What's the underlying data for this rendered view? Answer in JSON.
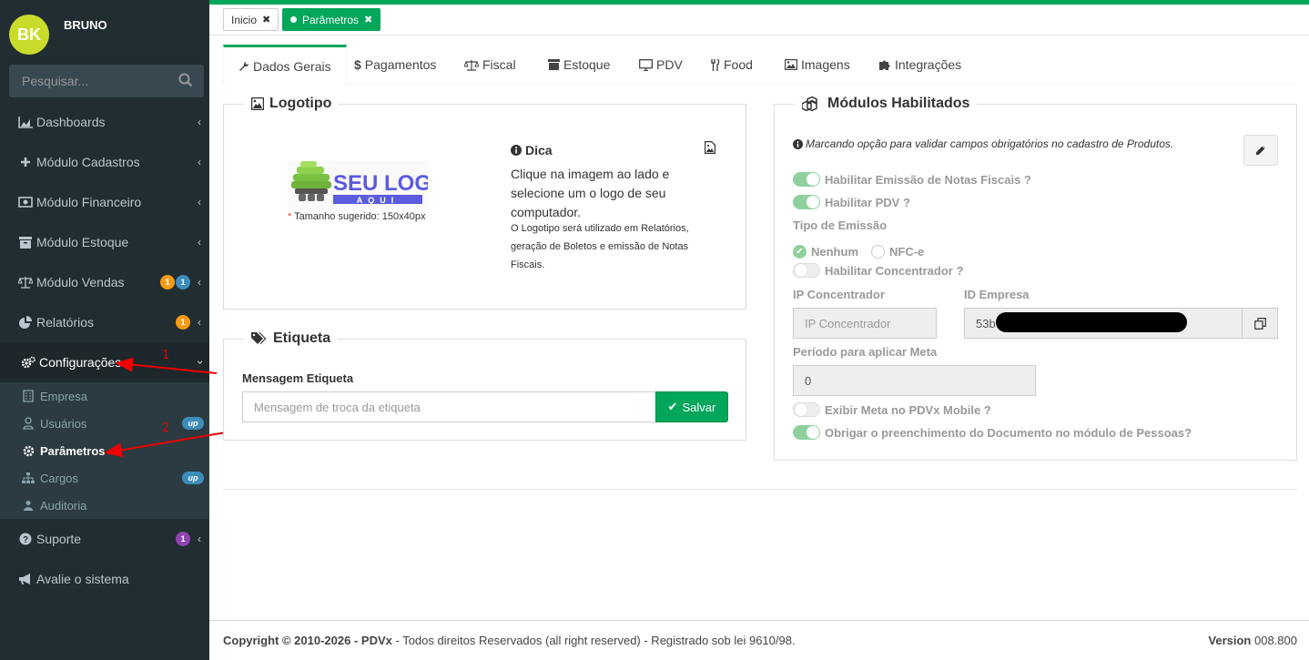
{
  "user": {
    "initials": "BK",
    "name": "BRUNO"
  },
  "search": {
    "placeholder": "Pesquisar..."
  },
  "menu": [
    {
      "label": "Dashboards"
    },
    {
      "label": "Módulo Cadastros"
    },
    {
      "label": "Módulo Financeiro"
    },
    {
      "label": "Módulo Estoque"
    },
    {
      "label": "Módulo Vendas",
      "badges": [
        "1",
        "1"
      ]
    },
    {
      "label": "Relatórios",
      "badges": [
        "1"
      ]
    },
    {
      "label": "Configurações"
    },
    {
      "label": "Suporte",
      "badges": [
        "1"
      ]
    },
    {
      "label": "Avalie o sistema"
    }
  ],
  "submenu": [
    {
      "label": "Empresa"
    },
    {
      "label": "Usuários",
      "badge": "up"
    },
    {
      "label": "Parâmetros"
    },
    {
      "label": "Cargos",
      "badge": "up"
    },
    {
      "label": "Auditoria"
    }
  ],
  "annotations": {
    "one": "1",
    "two": "2"
  },
  "breadcrumbs": [
    {
      "label": "Inicio"
    },
    {
      "label": "Parâmetros"
    }
  ],
  "tabs": [
    {
      "label": "Dados Gerais"
    },
    {
      "label": "Pagamentos"
    },
    {
      "label": "Fiscal"
    },
    {
      "label": "Estoque"
    },
    {
      "label": "PDV"
    },
    {
      "label": "Food"
    },
    {
      "label": "Imagens"
    },
    {
      "label": "Integrações"
    }
  ],
  "logotipo": {
    "title": "Logotipo",
    "logo_main": "SEU LOGO",
    "logo_sub": "AQUI",
    "hint_star": "*",
    "hint": "Tamanho sugerido: 150x40px",
    "dica_title": "Dica",
    "dica_text": "Clique na imagem ao lado e selecione um o logo de seu computador.",
    "dica_small": "O Logotipo será utilizado em Relatórios, geração de Boletos e emissão de Notas Fiscais."
  },
  "etiqueta": {
    "title": "Etiqueta",
    "label": "Mensagem Etiqueta",
    "placeholder": "Mensagem de troca da etiqueta",
    "save": "Salvar"
  },
  "modulos": {
    "title": "Módulos Habilitados",
    "info": "Marcando opção para validar campos obrigatórios no cadastro de Produtos.",
    "toggle_nf": "Habilitar Emissão de Notas Fiscais ?",
    "toggle_pdv": "Habilitar PDV ?",
    "tipo_label": "Tipo de Emissão",
    "radio_nenhum": "Nenhum",
    "radio_nfce": "NFC-e",
    "toggle_conc": "Habilitar Concentrador ?",
    "ip_label": "IP Concentrador",
    "ip_placeholder": "IP Concentrador",
    "id_label": "ID Empresa",
    "id_value": "53b",
    "periodo_label": "Período para aplicar Meta",
    "periodo_value": "0",
    "toggle_meta": "Exibir Meta no PDVx Mobile ?",
    "toggle_doc": "Obrigar o preenchimento do Documento no módulo de Pessoas?"
  },
  "footer": {
    "copy_label": "Copyright © 2010-2026 - ",
    "brand": "PDVx",
    "text": " - Todos direitos Reservados (all right reserved) - Registrado sob lei 9610/98.",
    "version_label": "Version",
    "version": "008.800"
  },
  "colors": {
    "accent": "#00a65a",
    "sidebar": "#222d32",
    "badge_orange": "#f39c12",
    "badge_blue": "#3c8dbc",
    "badge_purple": "#8e44ad"
  }
}
